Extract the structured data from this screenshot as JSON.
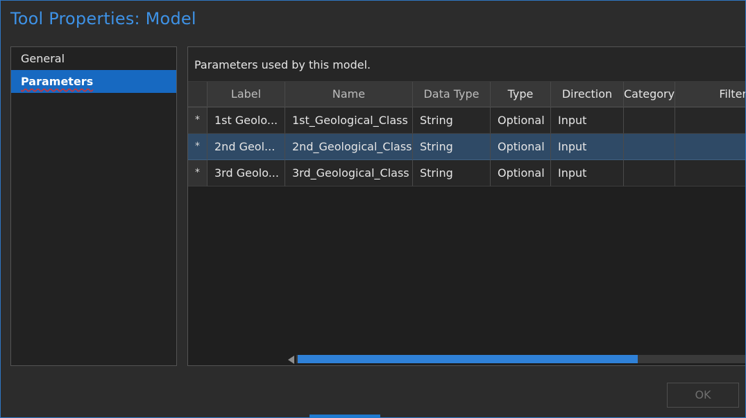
{
  "window": {
    "title": "Tool Properties: Model"
  },
  "nav": {
    "items": [
      {
        "label": "General"
      },
      {
        "label": "Parameters"
      }
    ]
  },
  "panel": {
    "description": "Parameters used by this model."
  },
  "table": {
    "columns": [
      "",
      "Label",
      "Name",
      "Data Type",
      "Type",
      "Direction",
      "Category",
      "Filter"
    ],
    "rows": [
      {
        "marker": "*",
        "label": "1st Geolo...",
        "name": "1st_Geological_Class",
        "data_type": "String",
        "type": "Optional",
        "direction": "Input",
        "category": "",
        "filter": ""
      },
      {
        "marker": "*",
        "label": "2nd Geol...",
        "name": "2nd_Geological_Class",
        "data_type": "String",
        "type": "Optional",
        "direction": "Input",
        "category": "",
        "filter": ""
      },
      {
        "marker": "*",
        "label": "3rd Geolo...",
        "name": "3rd_Geological_Class",
        "data_type": "String",
        "type": "Optional",
        "direction": "Input",
        "category": "",
        "filter": ""
      }
    ],
    "selected_row": 1
  },
  "footer": {
    "ok_label": "OK"
  },
  "colors": {
    "accent": "#1769c1",
    "title": "#3e92e6",
    "selection": "#2f4a66"
  }
}
